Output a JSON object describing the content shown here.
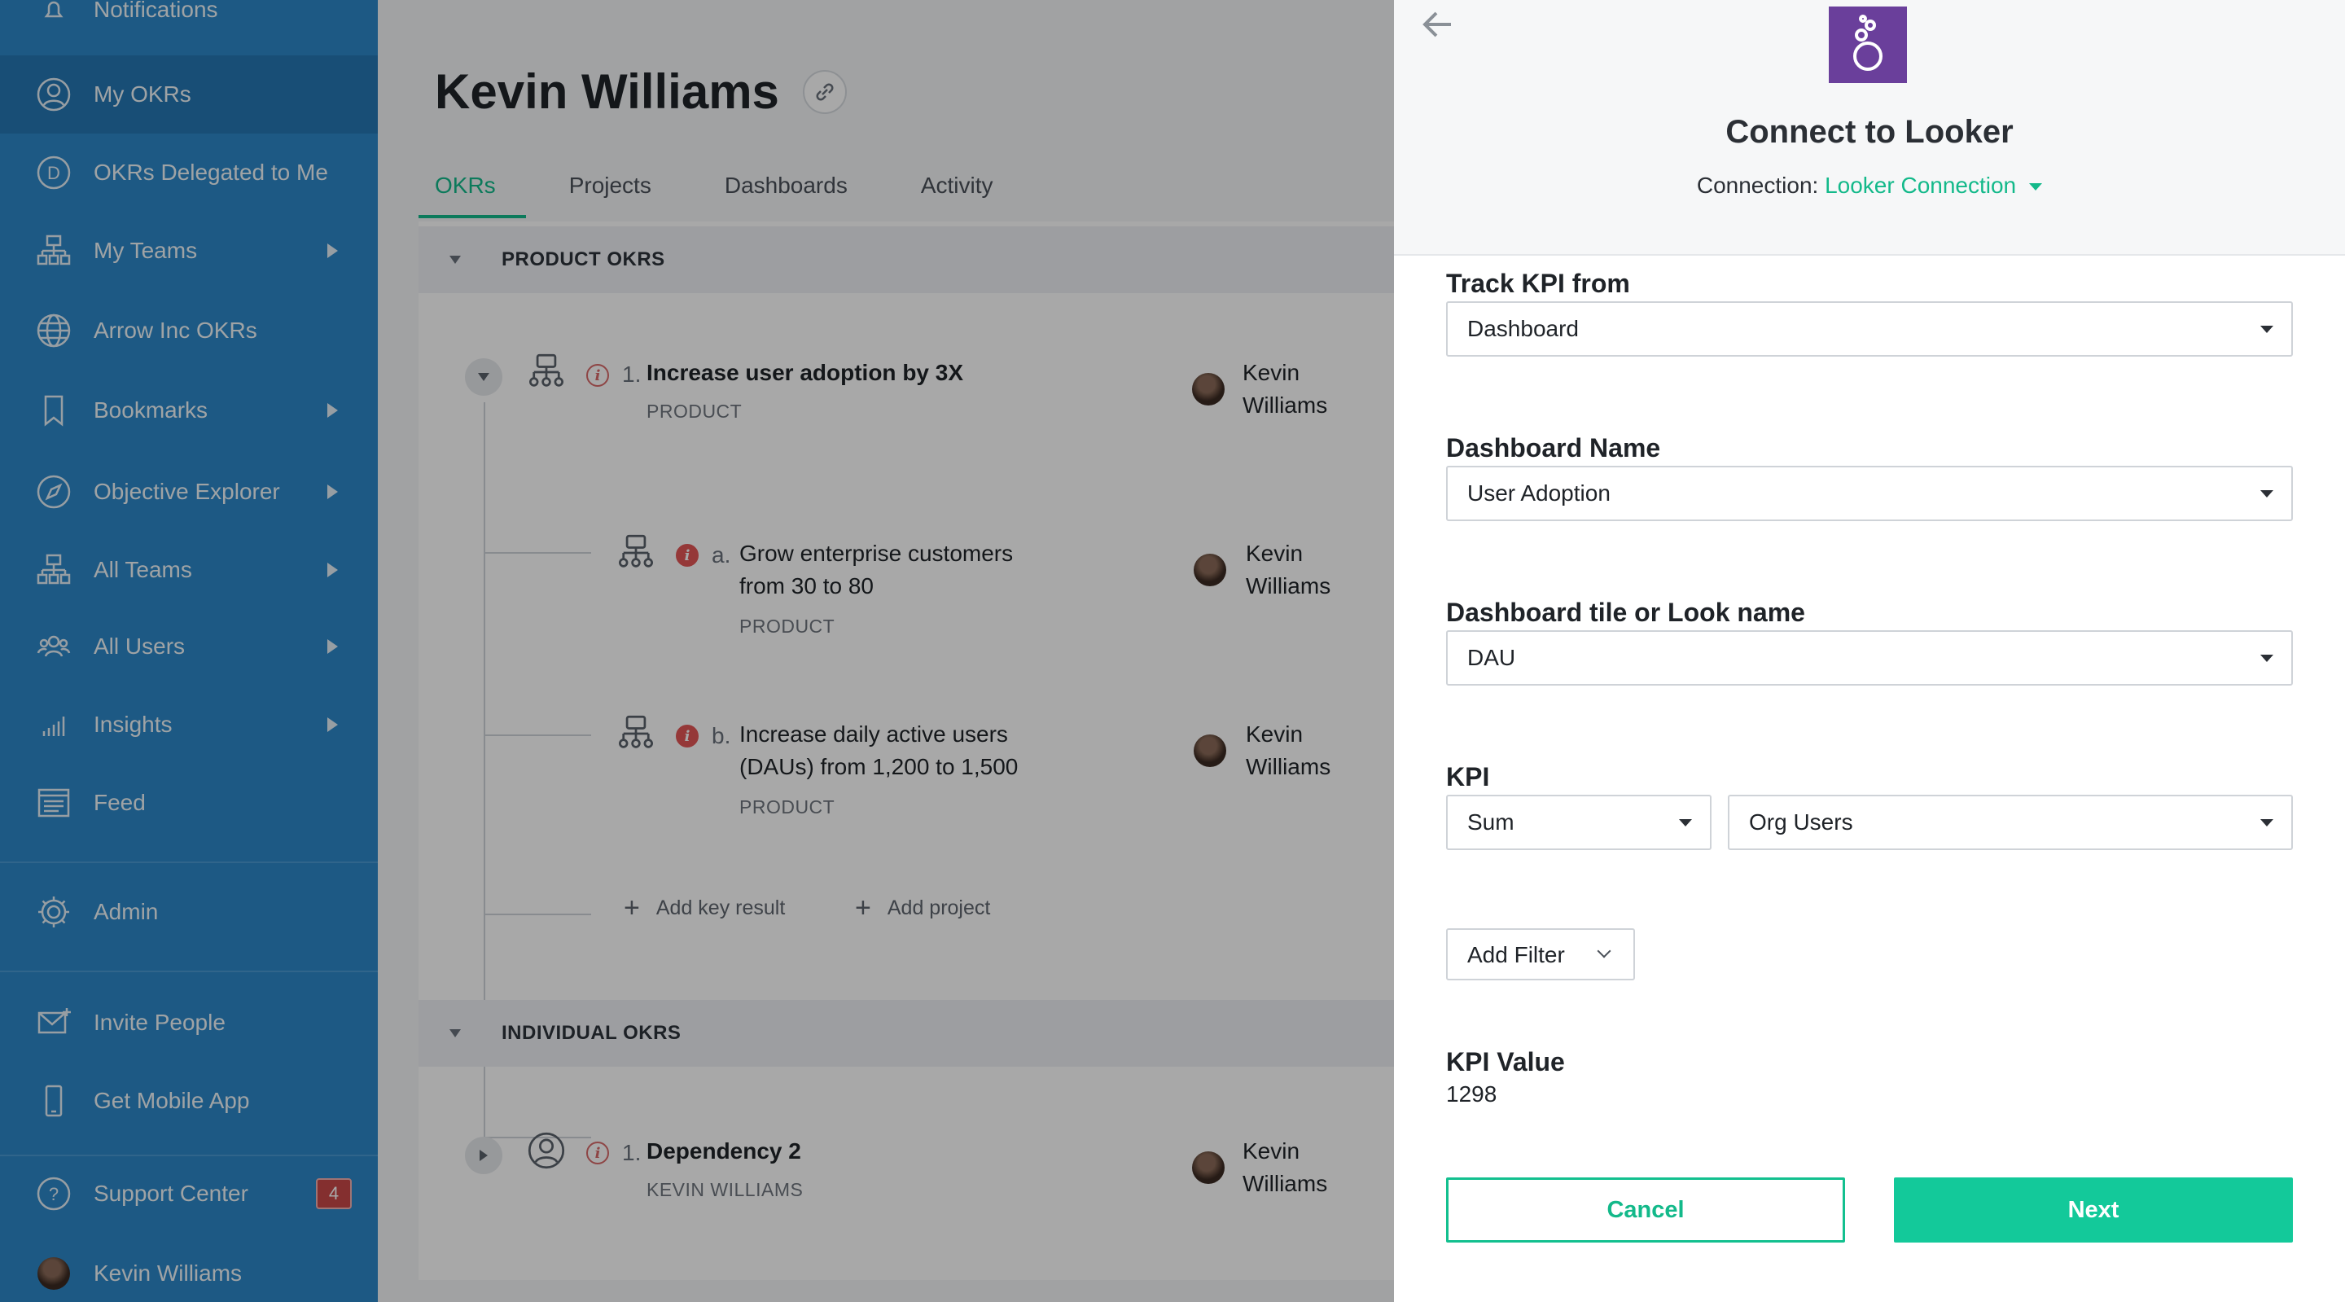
{
  "sidebar": {
    "top_partial": "Notifications",
    "items": [
      {
        "label": "My OKRs",
        "icon": "user-circle-icon"
      },
      {
        "label": "OKRs Delegated to Me",
        "icon": "delegate-icon"
      },
      {
        "label": "My Teams",
        "icon": "org-chart-icon"
      },
      {
        "label": "Arrow Inc OKRs",
        "icon": "globe-icon"
      },
      {
        "label": "Bookmarks",
        "icon": "bookmark-icon"
      },
      {
        "label": "Objective Explorer",
        "icon": "compass-icon"
      },
      {
        "label": "All Teams",
        "icon": "org-chart-icon"
      },
      {
        "label": "All Users",
        "icon": "users-icon"
      },
      {
        "label": "Insights",
        "icon": "bar-chart-icon"
      },
      {
        "label": "Feed",
        "icon": "feed-icon"
      },
      {
        "label": "Admin",
        "icon": "gear-icon"
      },
      {
        "label": "Invite People",
        "icon": "envelope-icon"
      },
      {
        "label": "Get Mobile App",
        "icon": "phone-icon"
      },
      {
        "label": "Support Center",
        "icon": "help-icon",
        "badge": "4"
      },
      {
        "label": "Kevin Williams",
        "icon": "avatar"
      }
    ]
  },
  "main": {
    "title": "Kevin Williams",
    "tabs": [
      "OKRs",
      "Projects",
      "Dashboards",
      "Activity"
    ],
    "active_tab": "OKRs",
    "groups": {
      "product": {
        "label": "PRODUCT OKRS",
        "objective": {
          "num": "1.",
          "title": "Increase user adoption by 3X",
          "sub": "PRODUCT",
          "owner_first": "Kevin",
          "owner_last": "Williams"
        },
        "key_results": [
          {
            "num": "a.",
            "line1": "Grow enterprise customers",
            "line2": "from 30 to 80",
            "sub": "PRODUCT",
            "owner_first": "Kevin",
            "owner_last": "Williams"
          },
          {
            "num": "b.",
            "line1": "Increase daily active users",
            "line2": "(DAUs) from 1,200 to 1,500",
            "sub": "PRODUCT",
            "owner_first": "Kevin",
            "owner_last": "Williams"
          }
        ],
        "add_key_result": "Add key result",
        "add_project": "Add project"
      },
      "individual": {
        "label": "INDIVIDUAL OKRS",
        "objective": {
          "num": "1.",
          "title": "Dependency 2",
          "sub": "KEVIN WILLIAMS",
          "owner_first": "Kevin",
          "owner_last": "Williams"
        }
      }
    }
  },
  "panel": {
    "title": "Connect to Looker",
    "connection_label": "Connection:",
    "connection_value": "Looker Connection",
    "fields": {
      "track_label": "Track KPI from",
      "track_value": "Dashboard",
      "dashboard_label": "Dashboard Name",
      "dashboard_value": "User Adoption",
      "tile_label": "Dashboard tile or Look name",
      "tile_value": "DAU",
      "kpi_label": "KPI",
      "kpi_agg": "Sum",
      "kpi_metric": "Org Users"
    },
    "add_filter": "Add Filter",
    "kpi_value_label": "KPI Value",
    "kpi_value": "1298",
    "cancel": "Cancel",
    "next": "Next",
    "colors": {
      "accent": "#13c99a",
      "looker": "#6a3f9b",
      "sidebar": "#2c87c8"
    }
  }
}
